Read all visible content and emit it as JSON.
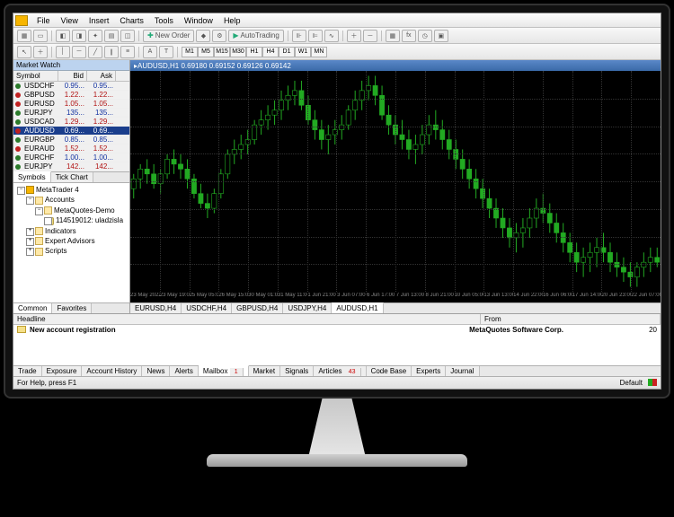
{
  "menu": {
    "file": "File",
    "view": "View",
    "insert": "Insert",
    "charts": "Charts",
    "tools": "Tools",
    "window": "Window",
    "help": "Help"
  },
  "toolbar": {
    "new_order": "New Order",
    "auto_trading": "AutoTrading"
  },
  "timeframes": [
    "M1",
    "M5",
    "M15",
    "M30",
    "H1",
    "H4",
    "D1",
    "W1",
    "MN"
  ],
  "market_watch": {
    "title": "Market Watch",
    "cols": {
      "symbol": "Symbol",
      "bid": "Bid",
      "ask": "Ask"
    },
    "rows": [
      {
        "sym": "USDCHF",
        "bid": "0.95...",
        "ask": "0.95...",
        "dir": "up",
        "bc": "blue",
        "ac": "blue"
      },
      {
        "sym": "GBPUSD",
        "bid": "1.22...",
        "ask": "1.22...",
        "dir": "dn",
        "bc": "red",
        "ac": "red"
      },
      {
        "sym": "EURUSD",
        "bid": "1.05...",
        "ask": "1.05...",
        "dir": "dn",
        "bc": "red",
        "ac": "red"
      },
      {
        "sym": "EURJPY",
        "bid": "135...",
        "ask": "135...",
        "dir": "up",
        "bc": "blue",
        "ac": "blue"
      },
      {
        "sym": "USDCAD",
        "bid": "1.29...",
        "ask": "1.29...",
        "dir": "up",
        "bc": "red",
        "ac": "red"
      },
      {
        "sym": "AUDUSD",
        "bid": "0.69...",
        "ask": "0.69...",
        "dir": "dn",
        "bc": "",
        "ac": "",
        "sel": true
      },
      {
        "sym": "EURGBP",
        "bid": "0.85...",
        "ask": "0.85...",
        "dir": "up",
        "bc": "blue",
        "ac": "blue"
      },
      {
        "sym": "EURAUD",
        "bid": "1.52...",
        "ask": "1.52...",
        "dir": "dn",
        "bc": "red",
        "ac": "red"
      },
      {
        "sym": "EURCHF",
        "bid": "1.00...",
        "ask": "1.00...",
        "dir": "up",
        "bc": "blue",
        "ac": "blue"
      },
      {
        "sym": "EURJPY",
        "bid": "142...",
        "ask": "142...",
        "dir": "up",
        "bc": "red",
        "ac": "red"
      }
    ],
    "tabs": {
      "symbols": "Symbols",
      "tick": "Tick Chart"
    }
  },
  "navigator": {
    "root": "MetaTrader 4",
    "accounts": "Accounts",
    "demo_server": "MetaQuotes-Demo",
    "account": "114519012: uladzisla",
    "indicators": "Indicators",
    "experts": "Expert Advisors",
    "scripts": "Scripts",
    "tabs": {
      "common": "Common",
      "favorites": "Favorites"
    }
  },
  "chart": {
    "title": "AUDUSD,H1  0.69180 0.69152 0.69126 0.69142",
    "tabs": [
      "EURUSD,H4",
      "USDCHF,H4",
      "GBPUSD,H4",
      "USDJPY,H4",
      "AUDUSD,H1"
    ],
    "active_tab": 4,
    "xlabels": [
      "23 May 2022",
      "23 May 19:00",
      "25 May 05:00",
      "26 May 15:00",
      "30 May 01:00",
      "31 May 11:00",
      "1 Jun 21:00",
      "3 Jun 07:00",
      "6 Jun 17:00",
      "7 Jun 13:00",
      "8 Jun 21:00",
      "10 Jun 05:00",
      "13 Jun 13:00",
      "14 Jun 22:00",
      "16 Jun 06:00",
      "17 Jun 14:00",
      "20 Jun 23:00",
      "22 Jun 07:00"
    ]
  },
  "terminal": {
    "cols": {
      "headline": "Headline",
      "from": "From"
    },
    "mail": {
      "subject": "New account registration",
      "from": "MetaQuotes Software Corp.",
      "date": "20"
    },
    "tabs": [
      "Trade",
      "Exposure",
      "Account History",
      "News",
      "Alerts",
      "Mailbox",
      "Market",
      "Signals",
      "Articles",
      "Code Base",
      "Experts",
      "Journal"
    ],
    "active_tab": 5,
    "mailbox_count": "1",
    "articles_count": "43"
  },
  "statusbar": {
    "help": "For Help, press F1",
    "profile": "Default"
  },
  "chart_data": {
    "type": "candlestick",
    "symbol": "AUDUSD",
    "timeframe": "H1",
    "y_range": [
      0.685,
      0.73
    ],
    "candles": [
      [
        0.706,
        0.709,
        0.704,
        0.708
      ],
      [
        0.708,
        0.711,
        0.706,
        0.71
      ],
      [
        0.71,
        0.712,
        0.707,
        0.709
      ],
      [
        0.709,
        0.711,
        0.706,
        0.707
      ],
      [
        0.707,
        0.71,
        0.705,
        0.709
      ],
      [
        0.709,
        0.713,
        0.708,
        0.712
      ],
      [
        0.712,
        0.714,
        0.709,
        0.711
      ],
      [
        0.711,
        0.713,
        0.708,
        0.71
      ],
      [
        0.71,
        0.712,
        0.706,
        0.708
      ],
      [
        0.708,
        0.709,
        0.704,
        0.705
      ],
      [
        0.705,
        0.707,
        0.702,
        0.703
      ],
      [
        0.703,
        0.705,
        0.7,
        0.702
      ],
      [
        0.702,
        0.706,
        0.701,
        0.705
      ],
      [
        0.705,
        0.71,
        0.704,
        0.709
      ],
      [
        0.709,
        0.714,
        0.708,
        0.713
      ],
      [
        0.713,
        0.716,
        0.711,
        0.714
      ],
      [
        0.714,
        0.717,
        0.712,
        0.715
      ],
      [
        0.715,
        0.718,
        0.713,
        0.716
      ],
      [
        0.716,
        0.72,
        0.715,
        0.719
      ],
      [
        0.719,
        0.722,
        0.717,
        0.72
      ],
      [
        0.72,
        0.723,
        0.718,
        0.721
      ],
      [
        0.721,
        0.724,
        0.719,
        0.722
      ],
      [
        0.722,
        0.726,
        0.72,
        0.724
      ],
      [
        0.724,
        0.727,
        0.722,
        0.725
      ],
      [
        0.725,
        0.728,
        0.723,
        0.726
      ],
      [
        0.726,
        0.728,
        0.722,
        0.723
      ],
      [
        0.723,
        0.725,
        0.719,
        0.72
      ],
      [
        0.72,
        0.722,
        0.716,
        0.718
      ],
      [
        0.718,
        0.72,
        0.714,
        0.716
      ],
      [
        0.716,
        0.719,
        0.713,
        0.717
      ],
      [
        0.717,
        0.72,
        0.715,
        0.718
      ],
      [
        0.718,
        0.721,
        0.716,
        0.719
      ],
      [
        0.719,
        0.723,
        0.718,
        0.722
      ],
      [
        0.722,
        0.726,
        0.72,
        0.724
      ],
      [
        0.724,
        0.728,
        0.722,
        0.726
      ],
      [
        0.726,
        0.729,
        0.724,
        0.727
      ],
      [
        0.727,
        0.729,
        0.723,
        0.725
      ],
      [
        0.725,
        0.727,
        0.72,
        0.721
      ],
      [
        0.721,
        0.723,
        0.717,
        0.719
      ],
      [
        0.719,
        0.721,
        0.715,
        0.717
      ],
      [
        0.717,
        0.72,
        0.714,
        0.716
      ],
      [
        0.716,
        0.718,
        0.712,
        0.714
      ],
      [
        0.714,
        0.717,
        0.711,
        0.715
      ],
      [
        0.715,
        0.719,
        0.713,
        0.717
      ],
      [
        0.717,
        0.721,
        0.715,
        0.719
      ],
      [
        0.719,
        0.722,
        0.716,
        0.718
      ],
      [
        0.718,
        0.72,
        0.714,
        0.716
      ],
      [
        0.716,
        0.718,
        0.712,
        0.714
      ],
      [
        0.714,
        0.716,
        0.71,
        0.712
      ],
      [
        0.712,
        0.714,
        0.708,
        0.71
      ],
      [
        0.71,
        0.712,
        0.706,
        0.708
      ],
      [
        0.708,
        0.71,
        0.704,
        0.706
      ],
      [
        0.706,
        0.708,
        0.702,
        0.704
      ],
      [
        0.704,
        0.706,
        0.7,
        0.702
      ],
      [
        0.702,
        0.704,
        0.698,
        0.7
      ],
      [
        0.7,
        0.702,
        0.696,
        0.698
      ],
      [
        0.698,
        0.7,
        0.694,
        0.696
      ],
      [
        0.696,
        0.699,
        0.693,
        0.697
      ],
      [
        0.697,
        0.7,
        0.694,
        0.698
      ],
      [
        0.698,
        0.702,
        0.696,
        0.7
      ],
      [
        0.7,
        0.704,
        0.698,
        0.702
      ],
      [
        0.702,
        0.705,
        0.699,
        0.701
      ],
      [
        0.701,
        0.703,
        0.697,
        0.699
      ],
      [
        0.699,
        0.701,
        0.695,
        0.697
      ],
      [
        0.697,
        0.699,
        0.693,
        0.695
      ],
      [
        0.695,
        0.697,
        0.691,
        0.693
      ],
      [
        0.693,
        0.695,
        0.689,
        0.691
      ],
      [
        0.691,
        0.694,
        0.688,
        0.692
      ],
      [
        0.692,
        0.695,
        0.689,
        0.693
      ],
      [
        0.693,
        0.696,
        0.69,
        0.694
      ],
      [
        0.694,
        0.697,
        0.691,
        0.693
      ],
      [
        0.693,
        0.695,
        0.689,
        0.691
      ],
      [
        0.691,
        0.693,
        0.688,
        0.69
      ],
      [
        0.69,
        0.692,
        0.687,
        0.689
      ],
      [
        0.689,
        0.691,
        0.686,
        0.688
      ],
      [
        0.688,
        0.691,
        0.686,
        0.69
      ],
      [
        0.69,
        0.693,
        0.688,
        0.691
      ],
      [
        0.691,
        0.694,
        0.689,
        0.692
      ],
      [
        0.692,
        0.694,
        0.69,
        0.691
      ]
    ]
  }
}
